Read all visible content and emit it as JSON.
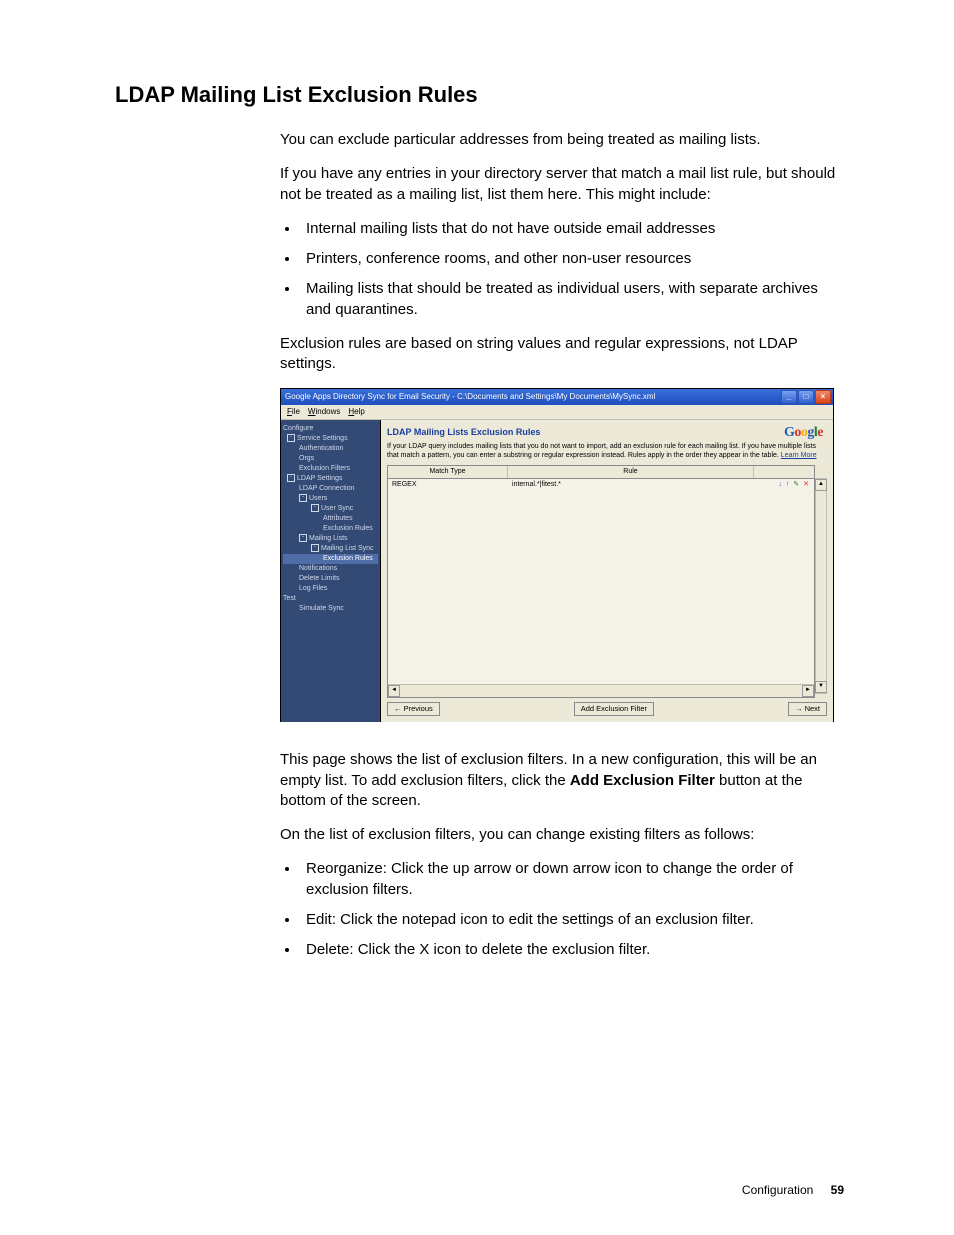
{
  "doc": {
    "section_title": "LDAP Mailing List Exclusion Rules",
    "p1": "You can exclude particular addresses from being treated as mailing lists.",
    "p2": "If you have any entries in your directory server that match a mail list rule, but should not be treated as a mailing list, list them here. This might include:",
    "bullets1": [
      "Internal mailing lists that do not have outside email addresses",
      "Printers, conference rooms, and other non-user resources",
      "Mailing lists that should be treated as individual users, with separate archives and quarantines."
    ],
    "p3": "Exclusion rules are based on string values and regular expressions, not LDAP settings.",
    "p4a": "This page shows the list of exclusion filters. In a new configuration, this will be an empty list. To add exclusion filters, click the ",
    "p4b_bold": "Add Exclusion Filter",
    "p4c": " button at the bottom of the screen.",
    "p5": "On the list of exclusion filters, you can change existing filters as follows:",
    "bullets2": [
      "Reorganize: Click the up arrow or down arrow icon to change the order of exclusion filters.",
      "Edit: Click the notepad icon to edit the settings of an exclusion filter.",
      "Delete: Click the X icon to delete the exclusion filter."
    ]
  },
  "screenshot": {
    "window_title": "Google Apps Directory Sync for Email Security - C:\\Documents and Settings\\My Documents\\MySync.xml",
    "menu": {
      "file": "File",
      "windows": "Windows",
      "help": "Help"
    },
    "tree": {
      "configure": "Configure",
      "service_settings": "Service Settings",
      "authentication": "Authentication",
      "orgs": "Orgs",
      "exclusion_filters": "Exclusion Filters",
      "ldap_settings": "LDAP Settings",
      "ldap_connection": "LDAP Connection",
      "users": "Users",
      "user_sync": "User Sync",
      "attributes": "Attributes",
      "exclusion_rules_u": "Exclusion Rules",
      "mailing_lists": "Mailing Lists",
      "mailing_list_sync": "Mailing List Sync",
      "exclusion_rules_m": "Exclusion Rules",
      "notifications": "Notifications",
      "delete_limits": "Delete Limits",
      "log_files": "Log Files",
      "test": "Test",
      "simulate_sync": "Simulate Sync"
    },
    "panel": {
      "title": "LDAP Mailing Lists Exclusion Rules",
      "desc_a": "If your LDAP query includes mailing lists that you do not want to import, add an exclusion rule for each mailing list. If you have multiple lists that match a pattern, you can enter a substring or regular expression instead. Rules apply in the order they appear in the table. ",
      "learn_more": "Learn More",
      "col_match": "Match Type",
      "col_rule": "Rule",
      "row_match": "REGEX",
      "row_rule": "internal.*|fitest.*",
      "btn_prev": "← Previous",
      "btn_add": "Add Exclusion Filter",
      "btn_next": "→ Next"
    },
    "google": {
      "g1": "G",
      "o1": "o",
      "o2": "o",
      "g2": "g",
      "l": "l",
      "e": "e"
    }
  },
  "footer": {
    "label": "Configuration",
    "page": "59"
  }
}
